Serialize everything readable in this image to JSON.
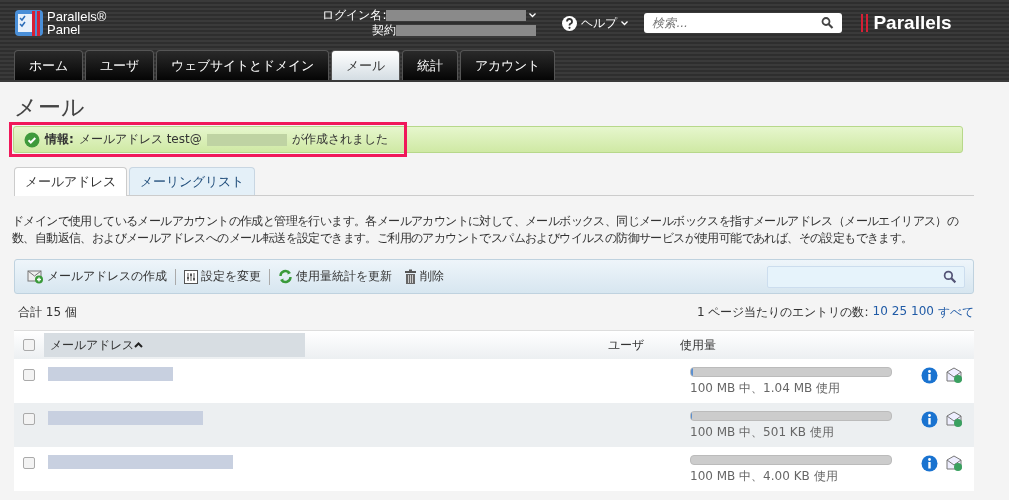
{
  "header": {
    "logo_text": [
      "Parallels®",
      "Panel"
    ],
    "login_label": "ログイン名:",
    "contract_label": "契約",
    "help": "ヘルプ",
    "search": {
      "placeholder": "検索..."
    },
    "brand": "Parallels"
  },
  "nav_tabs": [
    {
      "label": "ホーム",
      "selected": false
    },
    {
      "label": "ユーザ",
      "selected": false
    },
    {
      "label": "ウェブサイトとドメイン",
      "selected": false
    },
    {
      "label": "メール",
      "selected": true
    },
    {
      "label": "統計",
      "selected": false
    },
    {
      "label": "アカウント",
      "selected": false
    }
  ],
  "page_title": "メール",
  "notice": {
    "label": "情報:",
    "before": "メールアドレス test@",
    "after": "が作成されました",
    "highlighted": true
  },
  "sub_tabs": [
    {
      "label": "メールアドレス",
      "selected": true
    },
    {
      "label": "メーリングリスト",
      "selected": false
    }
  ],
  "description": "ドメインで使用しているメールアカウントの作成と管理を行います。各メールアカウントに対して、メールボックス、同じメールボックスを指すメールアドレス（メールエイリアス）の数、自動返信、およびメールアドレスへのメール転送を設定できます。ご利用のアカウントでスパムおよびウイルスの防御サービスが使用可能であれば、その設定もできます。",
  "toolbar": [
    {
      "kind": "create",
      "label": "メールアドレスの作成"
    },
    {
      "kind": "settings",
      "label": "設定を変更"
    },
    {
      "kind": "refresh",
      "label": "使用量統計を更新"
    },
    {
      "kind": "delete",
      "label": "削除"
    }
  ],
  "total": "合計 15 個",
  "per_page": {
    "label": "1 ページ当たりのエントリの数:",
    "options": [
      "10",
      "25",
      "100",
      "すべて"
    ]
  },
  "table": {
    "columns": [
      "メールアドレス",
      "ユーザ",
      "使用量"
    ],
    "select_all": false,
    "rows": [
      {
        "checked": false,
        "level": 0.01,
        "usage": "100 MB 中、1.04 MB 使用"
      },
      {
        "checked": false,
        "level": 0.005,
        "usage": "100 MB 中、501 KB 使用"
      },
      {
        "checked": false,
        "level": 0,
        "usage": "100 MB 中、4.00 KB 使用"
      }
    ]
  }
}
